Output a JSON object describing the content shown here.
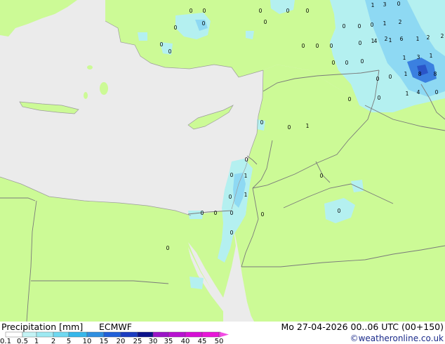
{
  "footer": {
    "title": "Precipitation [mm]",
    "product": "ECMWF",
    "datetime": "Mo 27-04-2026 00..06 UTC (00+150)",
    "credit": "©weatheronline.co.uk"
  },
  "legend": {
    "ticks": [
      "0.1",
      "0.5",
      "1",
      "2",
      "5",
      "10",
      "15",
      "20",
      "25",
      "30",
      "35",
      "40",
      "45",
      "50"
    ],
    "colors": [
      "#ffffff",
      "#c3f3f5",
      "#9ee9f2",
      "#6ed8f0",
      "#36b7ea",
      "#2f8fe0",
      "#2060d8",
      "#1b3cc0",
      "#0b128a",
      "#9a15c7",
      "#b812d1",
      "#d610d5",
      "#e816d8",
      "#f24ce4"
    ]
  },
  "map_colors": {
    "sea": "#ebebeb",
    "land": "#ccfa96",
    "border": "#7a7a7a",
    "precip_light": "#b4f0f0",
    "precip_mid": "#8ed9f3",
    "precip_heavy": "#3b80e0",
    "precip_core": "#2a55c8"
  },
  "station_values": [
    {
      "text": "0"
    },
    {
      "text": "0"
    },
    {
      "text": "0"
    },
    {
      "text": "0"
    },
    {
      "text": "0"
    },
    {
      "text": "0"
    },
    {
      "text": "0"
    },
    {
      "text": "0"
    },
    {
      "text": "0"
    },
    {
      "text": "0"
    },
    {
      "text": "0"
    },
    {
      "text": "0"
    },
    {
      "text": "0"
    },
    {
      "text": "0"
    },
    {
      "text": "0"
    },
    {
      "text": "1"
    },
    {
      "text": "3"
    },
    {
      "text": "0"
    },
    {
      "text": "0"
    },
    {
      "text": "1"
    },
    {
      "text": "2"
    },
    {
      "text": "1"
    },
    {
      "text": "2"
    },
    {
      "text": "0"
    },
    {
      "text": "4"
    },
    {
      "text": "1"
    },
    {
      "text": "6"
    },
    {
      "text": "1"
    },
    {
      "text": "2"
    },
    {
      "text": "2"
    },
    {
      "text": "1"
    },
    {
      "text": "3"
    },
    {
      "text": "1"
    },
    {
      "text": "1"
    },
    {
      "text": "8"
    },
    {
      "text": "8"
    },
    {
      "text": "0"
    },
    {
      "text": "0"
    },
    {
      "text": "1"
    },
    {
      "text": "4"
    },
    {
      "text": "0"
    },
    {
      "text": "0"
    },
    {
      "text": "0"
    },
    {
      "text": "0"
    },
    {
      "text": "0"
    },
    {
      "text": "0"
    },
    {
      "text": "0"
    },
    {
      "text": "0"
    },
    {
      "text": "1"
    },
    {
      "text": "0"
    },
    {
      "text": "0"
    },
    {
      "text": "1"
    },
    {
      "text": "1"
    },
    {
      "text": "0"
    },
    {
      "text": "0"
    },
    {
      "text": "0"
    },
    {
      "text": "0"
    },
    {
      "text": "0"
    },
    {
      "text": "0"
    },
    {
      "text": "0"
    },
    {
      "text": "0"
    },
    {
      "text": "0"
    }
  ]
}
